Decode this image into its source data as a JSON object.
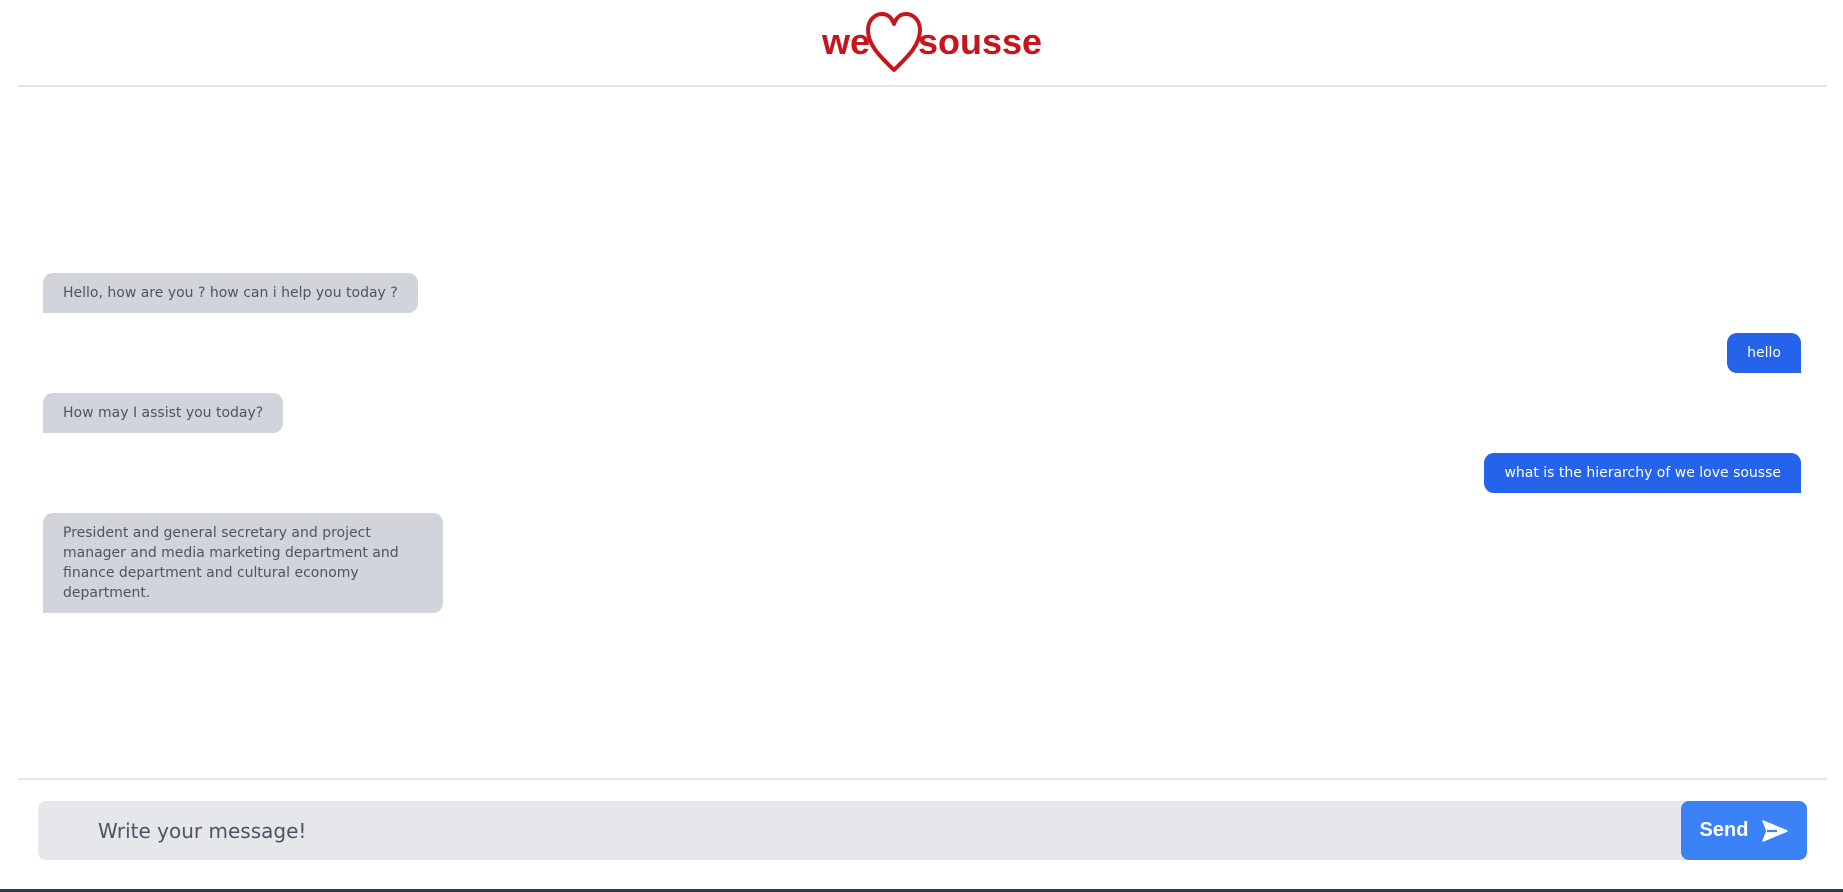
{
  "header": {
    "logo_left": "we",
    "logo_right": "sousse",
    "logo_heart_icon": "heart-icon",
    "brand_color": "#c4161c"
  },
  "messages": [
    {
      "sender": "bot",
      "text": "Hello, how are you ? how can i help you today ?"
    },
    {
      "sender": "user",
      "text": "hello"
    },
    {
      "sender": "bot",
      "text": "How may I assist you today?"
    },
    {
      "sender": "user",
      "text": "what is the hierarchy of we love sousse"
    },
    {
      "sender": "bot",
      "text": "President and general secretary and project manager and media marketing department and finance department and cultural economy department."
    }
  ],
  "composer": {
    "placeholder": "Write your message!",
    "value": "",
    "send_label": "Send",
    "send_icon": "paper-plane-icon"
  },
  "colors": {
    "bot_bubble": "#d1d5db",
    "user_bubble": "#2563eb",
    "send_button": "#3b82f6",
    "input_bg": "#e5e7eb"
  }
}
